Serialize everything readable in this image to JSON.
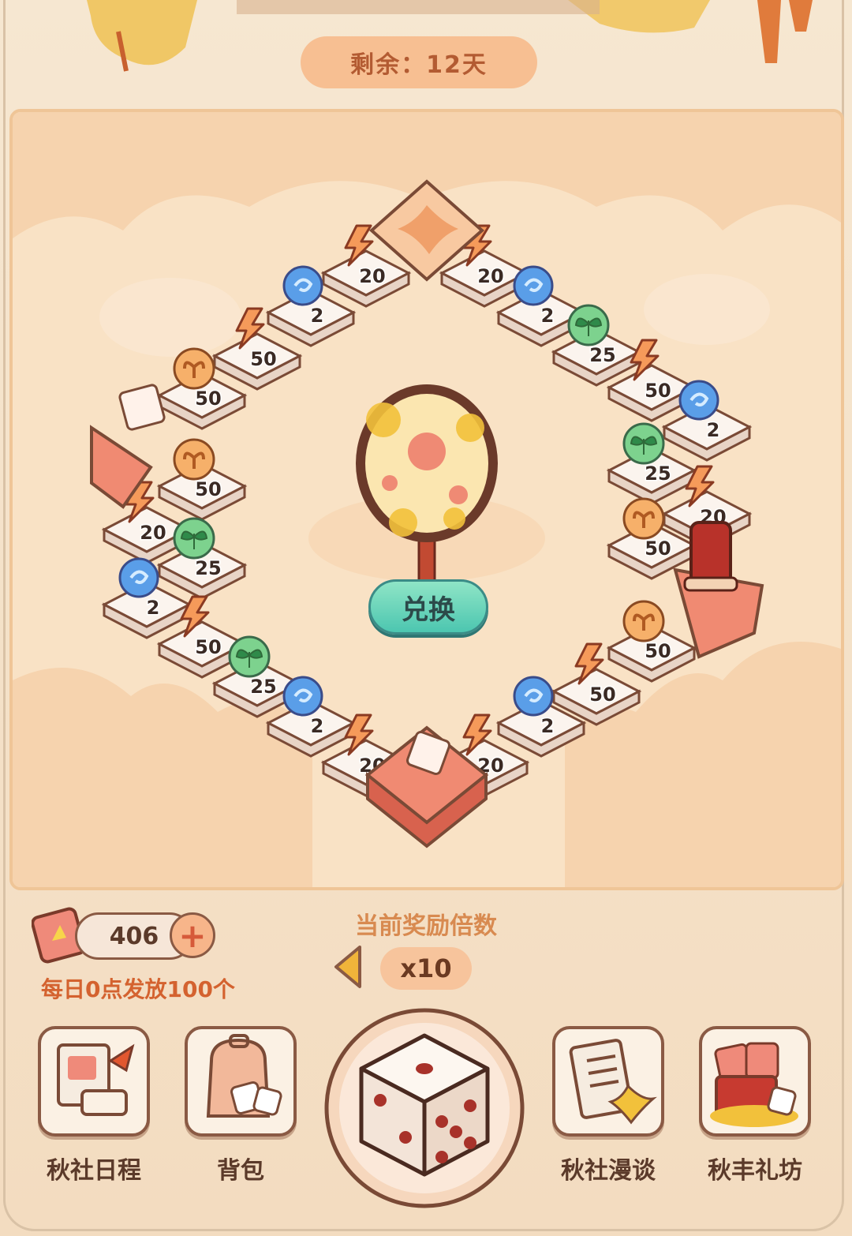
{
  "header": {
    "remaining": "剩余：12天"
  },
  "board": {
    "exchange_label": "兑换",
    "tiles": [
      {
        "icon": "energy-bolt-icon",
        "value": "20"
      },
      {
        "icon": "energy-bolt-icon",
        "value": "20"
      },
      {
        "icon": "blue-swirl-orb-icon",
        "value": "2"
      },
      {
        "icon": "blue-swirl-orb-icon",
        "value": "2"
      },
      {
        "icon": "energy-bolt-icon",
        "value": "50"
      },
      {
        "icon": "green-leaf-orb-icon",
        "value": "25"
      },
      {
        "icon": "orange-seed-coin-icon",
        "value": "50"
      },
      {
        "icon": "energy-bolt-icon",
        "value": "50"
      },
      {
        "icon": "blue-swirl-orb-icon",
        "value": "2"
      },
      {
        "icon": "orange-seed-coin-icon",
        "value": "50"
      },
      {
        "icon": "green-leaf-orb-icon",
        "value": "25"
      },
      {
        "icon": "energy-bolt-icon",
        "value": "20"
      },
      {
        "icon": "energy-bolt-icon",
        "value": "20"
      },
      {
        "icon": "orange-seed-coin-icon",
        "value": "50"
      },
      {
        "icon": "green-leaf-orb-icon",
        "value": "25"
      },
      {
        "icon": "blue-swirl-orb-icon",
        "value": "2"
      },
      {
        "icon": "orange-seed-coin-icon",
        "value": "50"
      },
      {
        "icon": "energy-bolt-icon",
        "value": "50"
      },
      {
        "icon": "energy-bolt-icon",
        "value": "50"
      },
      {
        "icon": "green-leaf-orb-icon",
        "value": "25"
      },
      {
        "icon": "blue-swirl-orb-icon",
        "value": "2"
      },
      {
        "icon": "blue-swirl-orb-icon",
        "value": "2"
      },
      {
        "icon": "energy-bolt-icon",
        "value": "20"
      },
      {
        "icon": "energy-bolt-icon",
        "value": "20"
      }
    ]
  },
  "wallet": {
    "ticket_count": "406",
    "plus": "+",
    "daily_note": "每日0点发放100个"
  },
  "multiplier": {
    "title": "当前奖励倍数",
    "value": "x10"
  },
  "nav": {
    "schedule": "秋社日程",
    "backpack": "背包",
    "talk": "秋社漫谈",
    "gift_shop": "秋丰礼坊"
  },
  "colors": {
    "accent": "#f7bf92",
    "text_dark": "#5b3a2a",
    "orange_text": "#d4622f",
    "exchange_green": "#4cc6b0"
  }
}
